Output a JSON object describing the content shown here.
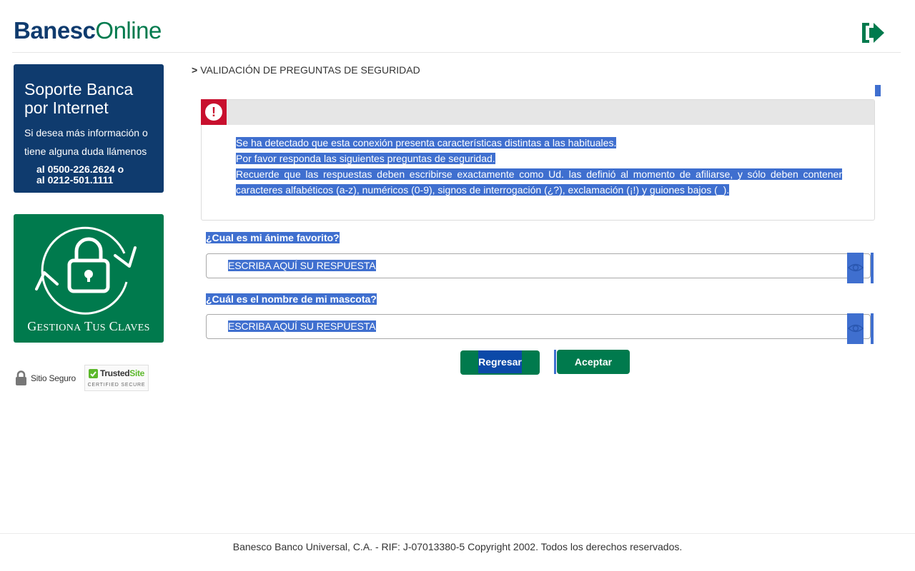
{
  "brand": {
    "name_bold": "Banesc",
    "name_light": "Online"
  },
  "header": {
    "logout_icon": "logout-icon"
  },
  "sidebar": {
    "support": {
      "title": "Soporte Banca por Internet",
      "description": "Si desea más información o tiene alguna duda llámenos",
      "phone_1": "al 0500-226.2624 o",
      "phone_2": "al 0212-501.1111"
    },
    "keys_card": {
      "label_big_1": "G",
      "label_small_1": "ESTIONA",
      "label_big_2": "T",
      "label_small_2": "US",
      "label_big_3": "C",
      "label_small_3": "LAVES"
    },
    "secure_label": "Sitio Seguro",
    "trusted": {
      "prefix": "Trusted",
      "suffix": "Site",
      "caption": "CERTIFIED SECURE"
    }
  },
  "breadcrumb": {
    "arrow": ">",
    "label": "VALIDACIÓN DE PREGUNTAS DE SEGURIDAD"
  },
  "alert": {
    "line_1": "Se ha detectado que esta conexión presenta características distintas a las habituales.",
    "line_2": "Por favor responda las siguientes preguntas de seguridad.",
    "line_3": "Recuerde que las respuestas deben escribirse exactamente como Ud. las definió al momento de afiliarse, y sólo deben contener caracteres alfabéticos (a-z), numéricos (0-9), signos de interrogación (¿?), exclamación (¡!) y guiones bajos (_)."
  },
  "questions": [
    {
      "label": "¿Cual es mi ánime favorito?",
      "value": "ESCRIBA AQUÍ SU RESPUESTA"
    },
    {
      "label": "¿Cuál es el nombre de mi mascota?",
      "value": "ESCRIBA AQUÍ SU RESPUESTA"
    }
  ],
  "buttons": {
    "back": "Regresar",
    "accept": "Aceptar"
  },
  "footer": "Banesco Banco Universal, C.A. - RIF: J-07013380-5 Copyright 2002. Todos los derechos reservados.",
  "colors": {
    "navy": "#0f3b6e",
    "green": "#007a4d",
    "alert_red": "#c8102e",
    "selection": "#3f6fcf"
  }
}
